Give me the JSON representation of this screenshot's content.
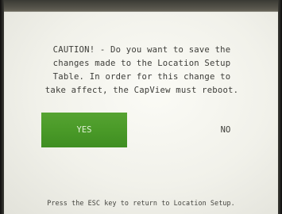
{
  "dialog": {
    "message_lines": [
      "CAUTION! - Do you want to save the",
      "changes made to the Location Setup",
      "Table.  In order for this change to",
      "take affect, the CapView must reboot."
    ],
    "yes_label": "YES",
    "no_label": "NO",
    "selected": "YES"
  },
  "footer": {
    "hint": "Press the ESC key to return to Location Setup."
  },
  "colors": {
    "screen_background": "#f3f3ec",
    "text": "#3c3c38",
    "selected_button": "#4a9a28",
    "selected_button_text": "#e3f2d8"
  }
}
